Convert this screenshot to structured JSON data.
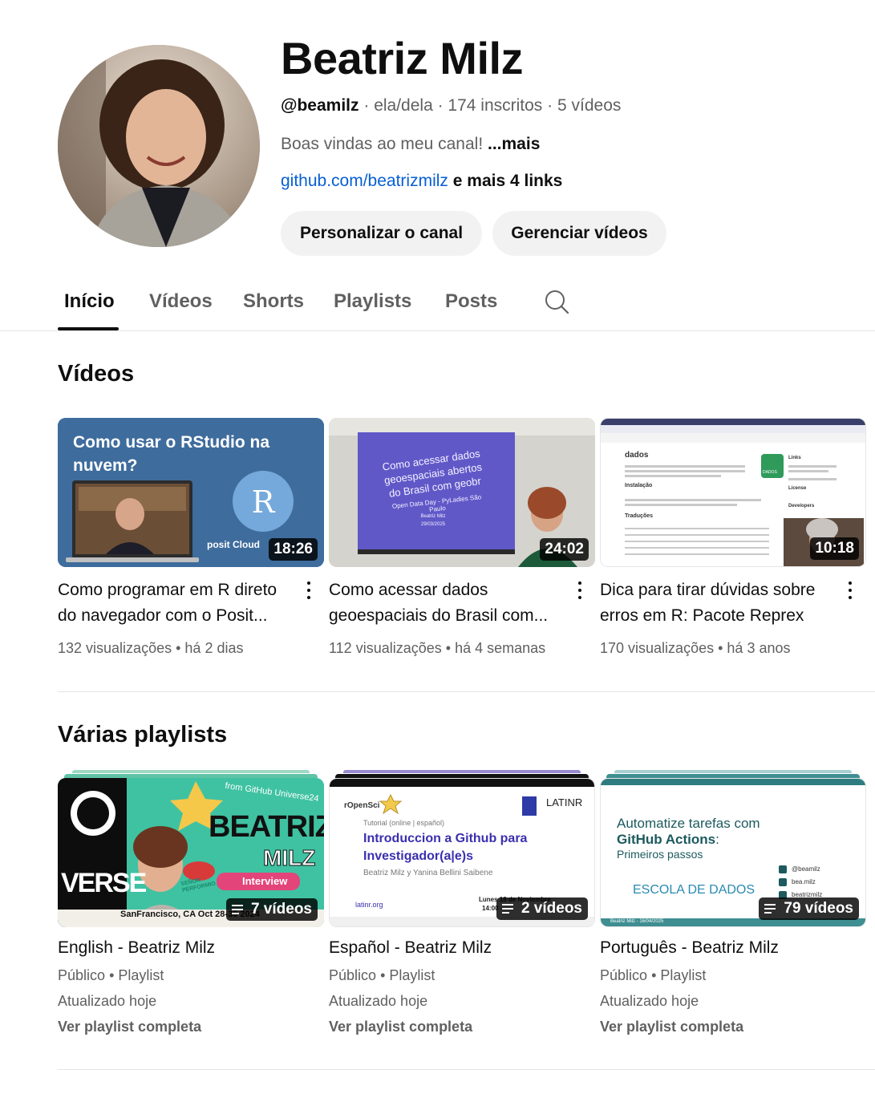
{
  "channel": {
    "name": "Beatriz Milz",
    "handle": "@beamilz",
    "pronouns": "ela/dela",
    "subscribers": "174 inscritos",
    "video_count": "5 vídeos",
    "description": "Boas vindas ao meu canal!",
    "more_label": "...mais",
    "link": "github.com/beatrizmilz",
    "more_links": "e mais 4 links",
    "customize_button": "Personalizar o canal",
    "manage_button": "Gerenciar vídeos"
  },
  "tabs": [
    "Início",
    "Vídeos",
    "Shorts",
    "Playlists",
    "Posts"
  ],
  "videos_section": {
    "title": "Vídeos",
    "items": [
      {
        "title_line1": "Como programar em R direto",
        "title_line2": "do navegador com o Posit...",
        "views": "132 visualizações",
        "age": "há 2 dias",
        "duration": "18:26",
        "thumb_heading": "Como usar o RStudio na nuvem?",
        "thumb_brand": "posit Cloud",
        "thumb_logo": "R"
      },
      {
        "title_line1": "Como acessar dados",
        "title_line2": "geoespaciais do Brasil com...",
        "views": "112 visualizações",
        "age": "há 4 semanas",
        "duration": "24:02",
        "thumb_slide_title": "Como acessar dados geoespaciais abertos do Brasil com geobr",
        "thumb_slide_sub": "Open Data Day - PyLadies São Paulo",
        "thumb_slide_author": "Beatriz Milz",
        "thumb_slide_date": "29/03/2025"
      },
      {
        "title_line1": "Dica para tirar dúvidas sobre",
        "title_line2": "erros em R: Pacote Reprex",
        "views": "170 visualizações",
        "age": "há 3 anos",
        "duration": "10:18",
        "thumb_page_title": "dados",
        "thumb_install": "Instalação",
        "thumb_trans": "Traduções",
        "thumb_links": "Links",
        "thumb_license": "License",
        "thumb_devs": "Developers",
        "thumb_hex": "DADOS"
      }
    ]
  },
  "playlists_section": {
    "title": "Várias playlists",
    "items": [
      {
        "title": "English - Beatriz Milz",
        "visibility": "Público",
        "type": "Playlist",
        "updated": "Atualizado hoje",
        "link": "Ver playlist completa",
        "count": "7 vídeos",
        "thumb_name1": "BEATRIZ",
        "thumb_name2": "MILZ",
        "thumb_tag": "Interview",
        "thumb_ribbon": "from GitHub Universe24",
        "thumb_side": "VERSE",
        "thumb_badge": "SEÑOR PERFORMIO",
        "thumb_footer": "SanFrancisco, CA Oct 28-30 2024"
      },
      {
        "title": "Español - Beatriz Milz",
        "visibility": "Público",
        "type": "Playlist",
        "updated": "Atualizado hoje",
        "link": "Ver playlist completa",
        "count": "2 vídeos",
        "thumb_org": "rOpenSci",
        "thumb_brand": "LATINR",
        "thumb_small": "Tutorial (online | español)",
        "thumb_heading": "Introduccion a Github para Investigador(a|e)s",
        "thumb_authors": "Beatriz Milz y Yanina Bellini Saibene",
        "thumb_site": "latinr.org",
        "thumb_date": "Lunes 18 de Noviembre",
        "thumb_time": "14:00 -"
      },
      {
        "title": "Português - Beatriz Milz",
        "visibility": "Público",
        "type": "Playlist",
        "updated": "Atualizado hoje",
        "link": "Ver playlist completa",
        "count": "79 vídeos",
        "thumb_line1": "Automatize tarefas com",
        "thumb_line2": "GitHub Actions",
        "thumb_line2_suffix": ":",
        "thumb_line3": "Primeiros passos",
        "thumb_school": "ESCOLA DE DADOS",
        "thumb_social1": "@beamilz",
        "thumb_social2": "bea.milz",
        "thumb_social3": "beatrizmilz",
        "thumb_footer": "Beatriz Milz - 16/04/2025"
      }
    ]
  },
  "colors": {
    "link_blue": "#065fd4",
    "text_primary": "#0f0f0f",
    "text_secondary": "#606060",
    "button_bg": "#f2f2f2"
  }
}
